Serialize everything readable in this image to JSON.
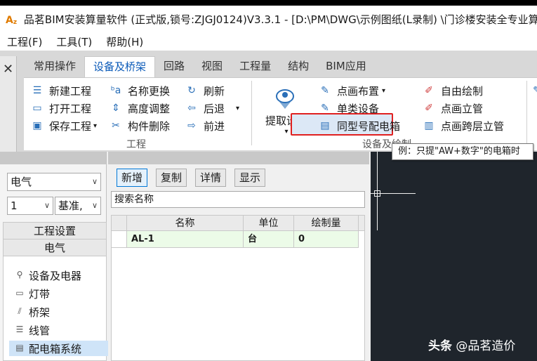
{
  "titlebar": {
    "title": "品茗BIM安装算量软件 (正式版,锁号:ZJGJ0124)V3.3.1 - [D:\\PM\\DWG\\示例图纸(L录制) \\门诊楼安装全专业算"
  },
  "menu": [
    "工程(F)",
    "工具(T)",
    "帮助(H)"
  ],
  "tabs": [
    "常用操作",
    "设备及桥架",
    "回路",
    "视图",
    "工程量",
    "结构",
    "BIM应用"
  ],
  "ribbon": {
    "project_group": {
      "label": "工程",
      "new": "新建工程",
      "open": "打开工程",
      "save": "保存工程",
      "rename": "名称更换",
      "height": "高度调整",
      "delete": "构件删除",
      "refresh": "刷新",
      "back": "后退",
      "forward": "前进"
    },
    "equipment_group": {
      "label": "设备及绘制",
      "extract": "提取设备",
      "point_layout": "点画布置",
      "single_type": "单类设备",
      "same_model": "同型号配电箱",
      "free_draw": "自由绘制",
      "point_riser": "点画立管",
      "cross_floor_riser": "点画跨层立管"
    }
  },
  "tooltip": "例：只提\"AW+数字\"的电箱时",
  "left_panel": {
    "category": "电气",
    "floor": "1",
    "base": "基准,",
    "nav_header1": "工程设置",
    "nav_header2": "电气",
    "items": [
      "设备及电器",
      "灯带",
      "桥架",
      "线管",
      "配电箱系统"
    ]
  },
  "mid_panel": {
    "buttons": [
      "新增",
      "复制",
      "详情",
      "显示"
    ],
    "search_placeholder": "搜索名称",
    "columns": [
      "名称",
      "单位",
      "绘制量"
    ],
    "rows": [
      {
        "name": "AL-1",
        "unit": "台",
        "count": "0"
      }
    ]
  },
  "watermark": {
    "platform": "头条",
    "handle": "@品茗造价"
  }
}
